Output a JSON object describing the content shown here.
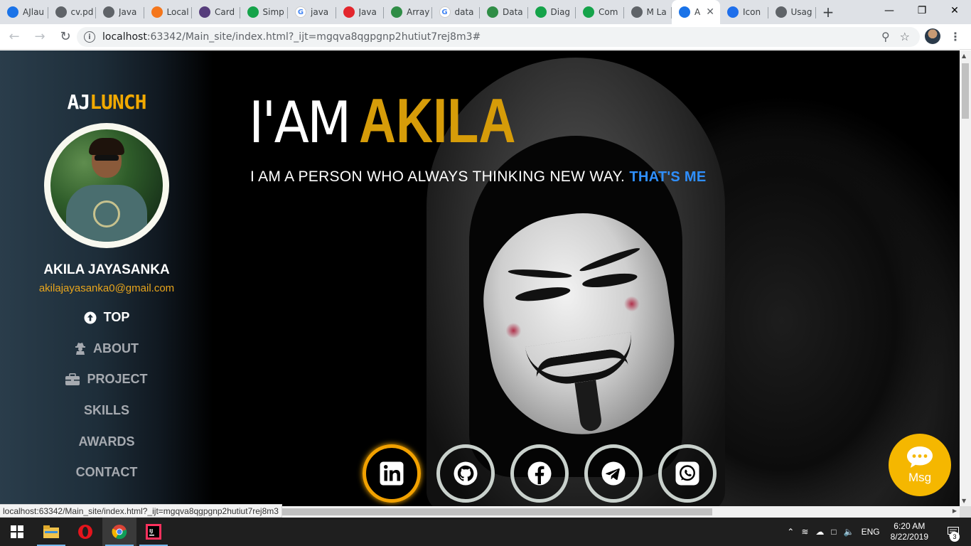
{
  "browser": {
    "tabs": [
      {
        "label": "AJlau",
        "fav_color": "#1a73e8",
        "icon": "portfolio-icon"
      },
      {
        "label": "cv.pd",
        "fav_color": "#5f6368",
        "icon": "globe-icon"
      },
      {
        "label": "Java",
        "fav_color": "#5f6368",
        "icon": "globe-icon"
      },
      {
        "label": "Local",
        "fav_color": "#f4761c",
        "icon": "location-icon"
      },
      {
        "label": "Card",
        "fav_color": "#563d7c",
        "icon": "bootstrap-icon"
      },
      {
        "label": "Simp",
        "fav_color": "#15a34a",
        "icon": "h-icon"
      },
      {
        "label": "java",
        "fav_color": "#ffffff",
        "icon": "google-icon"
      },
      {
        "label": "Java",
        "fav_color": "#e3262d",
        "icon": "triangle-icon"
      },
      {
        "label": "Array",
        "fav_color": "#2f8d46",
        "icon": "gfg-icon"
      },
      {
        "label": "data",
        "fav_color": "#ffffff",
        "icon": "google-icon"
      },
      {
        "label": "Data",
        "fav_color": "#2f8d46",
        "icon": "gfg-icon"
      },
      {
        "label": "Diag",
        "fav_color": "#15a34a",
        "icon": "h-icon"
      },
      {
        "label": "Com",
        "fav_color": "#15a34a",
        "icon": "h-icon"
      },
      {
        "label": "M La",
        "fav_color": "#5f6368",
        "icon": "globe-icon"
      },
      {
        "label": "A",
        "fav_color": "#1a73e8",
        "icon": "portfolio-icon",
        "active": true
      },
      {
        "label": "Icon",
        "fav_color": "#1f6feb",
        "icon": "flag-icon"
      },
      {
        "label": "Usag",
        "fav_color": "#5f6368",
        "icon": "book-icon"
      }
    ],
    "new_tab": "+",
    "url_host": "localhost",
    "url_rest": ":63342/Main_site/index.html?_ijt=mgqva8qgpgnp2hutiut7rej8m3#",
    "status_url": "localhost:63342/Main_site/index.html?_ijt=mgqva8qgpgnp2hutiut7rej8m3"
  },
  "site": {
    "logo_a": "AJ",
    "logo_b": "LUNCH",
    "profile_name": "AKILA JAYASANKA",
    "email": "akilajayasanka0@gmail.com",
    "nav": [
      {
        "label": "TOP",
        "icon": "arrow-up-circle-icon",
        "active": true
      },
      {
        "label": "ABOUT",
        "icon": "user-secret-icon"
      },
      {
        "label": "PROJECT",
        "icon": "briefcase-icon"
      },
      {
        "label": "SKILLS",
        "icon": ""
      },
      {
        "label": "AWARDS",
        "icon": ""
      },
      {
        "label": "CONTACT",
        "icon": ""
      }
    ],
    "hero_prefix": "I'AM",
    "hero_name": "AKILA",
    "tagline": "I AM A PERSON WHO ALWAYS THINKING NEW WAY.",
    "tagline_highlight": "THAT'S ME",
    "socials": [
      "linkedin-icon",
      "github-icon",
      "facebook-icon",
      "telegram-icon",
      "whatsapp-icon"
    ],
    "msg_label": "Msg",
    "colors": {
      "accent": "#d69c09",
      "highlight": "#2f8fff",
      "msg_bg": "#f5b700"
    }
  },
  "taskbar": {
    "language": "ENG",
    "time": "6:20 AM",
    "date": "8/22/2019",
    "notifications": "3"
  }
}
